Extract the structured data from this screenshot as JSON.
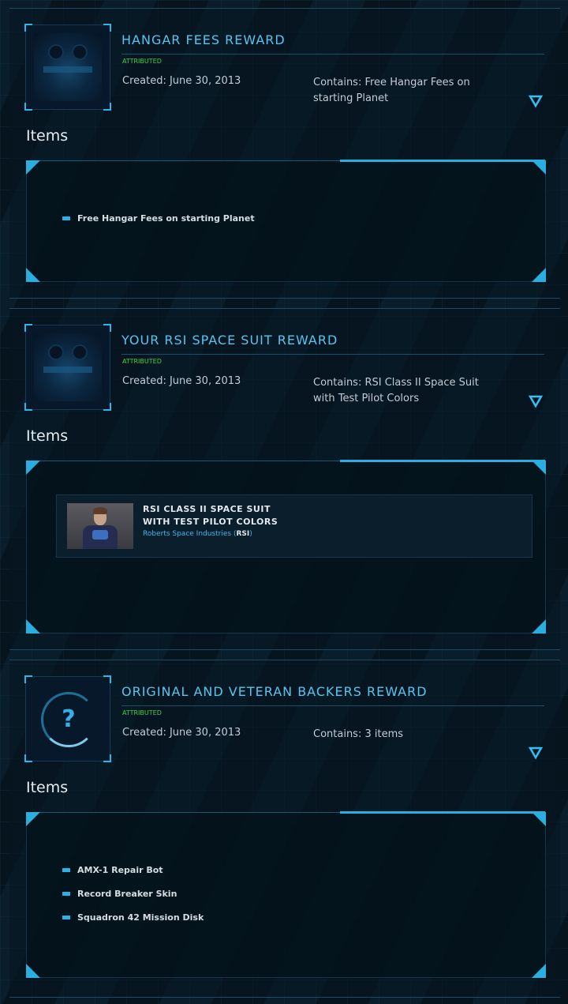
{
  "pledges": [
    {
      "title": "HANGAR FEES REWARD",
      "status": "ATTRIBUTED",
      "created": "Created: June 30, 2013",
      "contains": "Contains: Free Hangar Fees on starting Planet",
      "items_heading": "Items",
      "items": [
        "Free Hangar Fees on starting Planet"
      ]
    },
    {
      "title": "YOUR RSI SPACE SUIT REWARD",
      "status": "ATTRIBUTED",
      "created": "Created: June 30, 2013",
      "contains": "Contains: RSI Class II Space Suit with Test Pilot Colors",
      "items_heading": "Items",
      "item_card": {
        "name": "RSI CLASS II SPACE SUIT WITH TEST PILOT COLORS",
        "manufacturer": "Roberts Space Industries",
        "manufacturer_code": "RSI"
      }
    },
    {
      "title": "ORIGINAL AND VETERAN BACKERS REWARD",
      "status": "ATTRIBUTED",
      "created": "Created: June 30, 2013",
      "contains": "Contains: 3 items",
      "items_heading": "Items",
      "items": [
        "AMX-1 Repair Bot",
        "Record Breaker Skin",
        "Squadron 42 Mission Disk"
      ]
    }
  ],
  "colors": {
    "accent": "#58c5f0",
    "status_green": "#3fd24a",
    "background": "#07141f"
  },
  "icons": {
    "toggle": "chevron-down-triangle-icon",
    "unknown_thumb": "question-mark-icon"
  }
}
